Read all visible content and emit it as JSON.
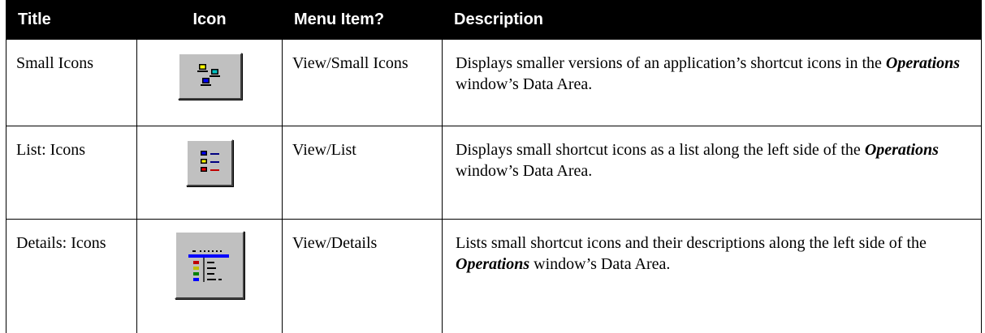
{
  "headers": {
    "title": "Title",
    "icon": "Icon",
    "menu_item": "Menu Item?",
    "description": "Description"
  },
  "rows": [
    {
      "title": "Small Icons",
      "icon": "small-icons-icon",
      "menu_item": "View/Small Icons",
      "desc_before": "Displays smaller versions of an application’s shortcut icons in the ",
      "desc_em": "Operations",
      "desc_after": " window’s Data Area."
    },
    {
      "title": "List: Icons",
      "icon": "list-icon",
      "menu_item": "View/List",
      "desc_before": "Displays small shortcut icons as a list along the left side of the ",
      "desc_em": "Operations",
      "desc_after": " window’s Data Area."
    },
    {
      "title": "Details: Icons",
      "icon": "details-icon",
      "menu_item": "View/Details",
      "desc_before": "Lists small shortcut icons and their descriptions along the left side of the ",
      "desc_em": "Operations",
      "desc_after": " window’s Data Area."
    }
  ],
  "colors": {
    "header_bg": "#000000",
    "header_text": "#ffffff",
    "button_face": "#c0c0c0"
  }
}
